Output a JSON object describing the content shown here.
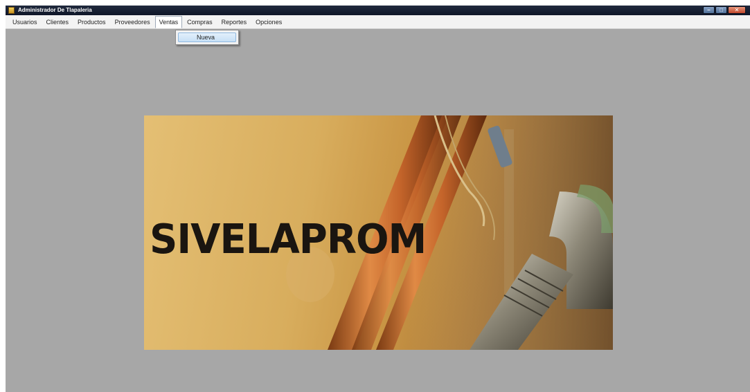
{
  "window": {
    "title": "Administrador De Tlapaleria",
    "controls": [
      "minimize",
      "maximize",
      "close"
    ]
  },
  "menu": {
    "items": [
      {
        "id": "usuarios",
        "label": "Usuarios"
      },
      {
        "id": "clientes",
        "label": "Clientes"
      },
      {
        "id": "productos",
        "label": "Productos"
      },
      {
        "id": "proveedores",
        "label": "Proveedores"
      },
      {
        "id": "ventas",
        "label": "Ventas"
      },
      {
        "id": "compras",
        "label": "Compras"
      },
      {
        "id": "reportes",
        "label": "Reportes"
      },
      {
        "id": "opciones",
        "label": "Opciones"
      }
    ],
    "active": "Ventas"
  },
  "dropdown": {
    "parent": "Ventas",
    "items": [
      {
        "label": "Nueva"
      }
    ]
  },
  "banner": {
    "logo_text": "SIVELAPROM",
    "image": "photo of copper pipes and galvanized pipe fitting"
  },
  "colors": {
    "titlebar": "#1a2234",
    "menubar": "#f3f3f3",
    "workspace": "#a7a7a7",
    "dropdown_highlight": "#c7e0f6",
    "logo": "#1a1510"
  }
}
